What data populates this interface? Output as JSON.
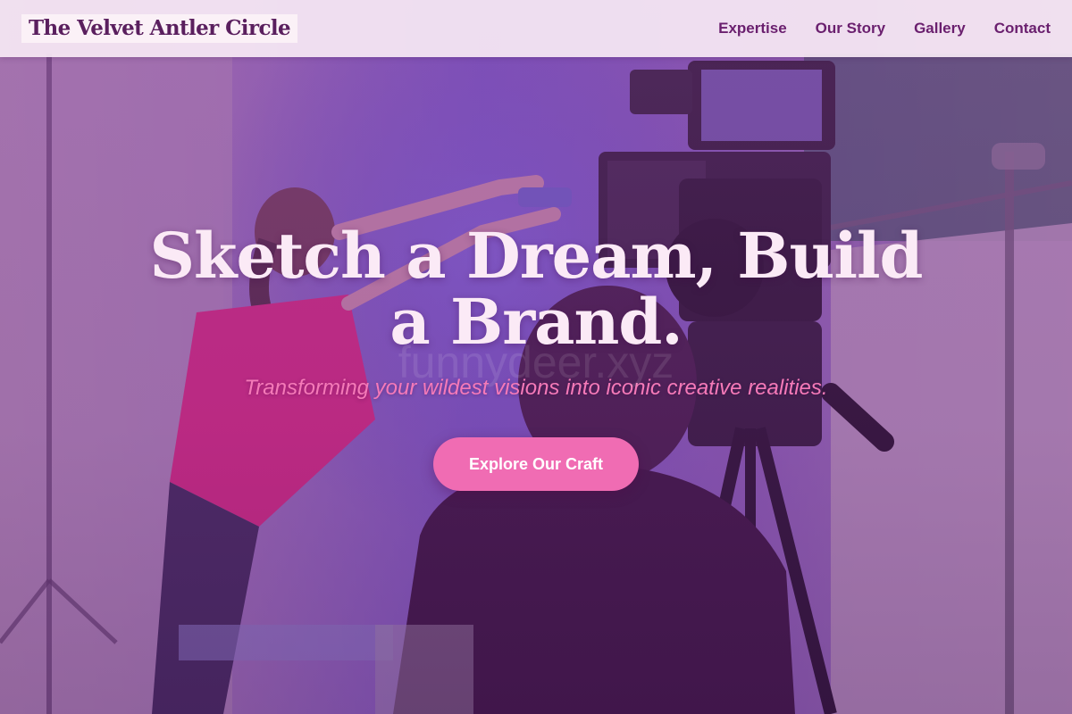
{
  "navbar": {
    "brand": "The Velvet Antler Circle",
    "links": [
      {
        "label": "Expertise"
      },
      {
        "label": "Our Story"
      },
      {
        "label": "Gallery"
      },
      {
        "label": "Contact"
      }
    ]
  },
  "hero": {
    "title": "Sketch a Dream, Build a Brand.",
    "subtitle": "Transforming your wildest visions into iconic creative realities.",
    "watermark": "funnydeer.xyz",
    "cta_label": "Explore Our Craft"
  },
  "colors": {
    "navbar_bg": "#f6e8f4",
    "brand_text": "#5a1f5e",
    "nav_link": "#6a1f6e",
    "hero_title": "#fbeaf6",
    "hero_subtitle": "#f57ab8",
    "cta_bg": "#f06cb3",
    "cta_text": "#ffffff"
  }
}
